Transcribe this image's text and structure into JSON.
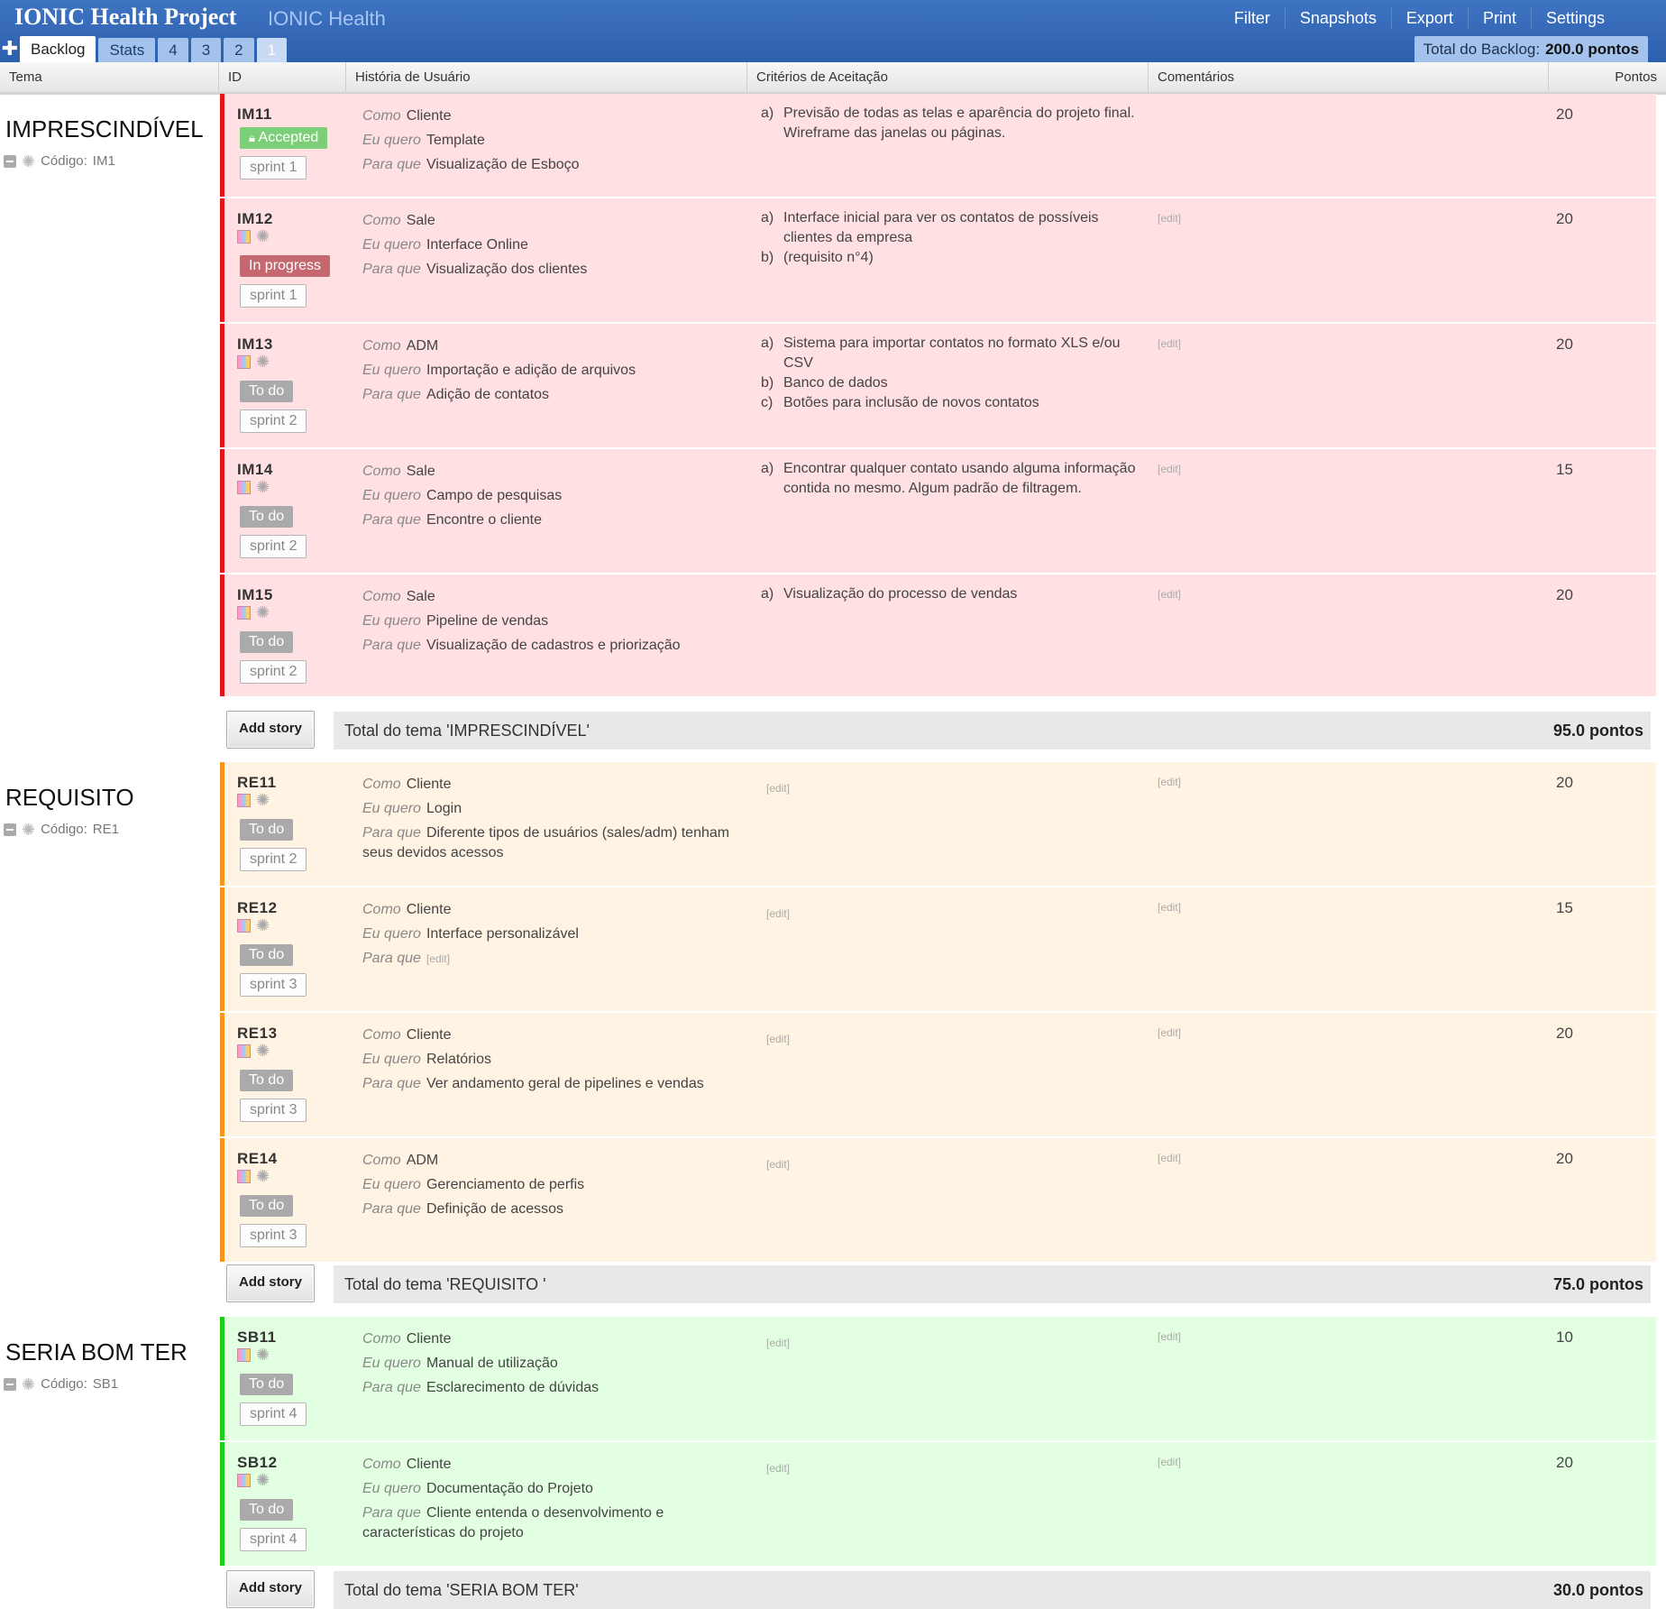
{
  "header": {
    "title": "IONIC Health Project",
    "subtitle": "IONIC Health",
    "menu": [
      "Filter",
      "Snapshots",
      "Export",
      "Print",
      "Settings"
    ],
    "tabs": [
      "Backlog",
      "Stats",
      "4",
      "3",
      "2",
      "1"
    ],
    "total_label": "Total do Backlog:",
    "total_value": "200.0 pontos"
  },
  "columns": [
    "Tema",
    "ID",
    "História de Usuário",
    "Critérios de Aceitação",
    "Comentários",
    "Pontos"
  ],
  "labels": {
    "como": "Como",
    "eu_quero": "Eu quero",
    "para_que": "Para que",
    "edit": "[edit]",
    "add_story": "Add story",
    "codigo": "Código:"
  },
  "colors": {
    "imprescindivel_bg": "#ffe0e3",
    "imprescindivel_bar": "#e3141d",
    "requisito_bg": "#fff3e3",
    "requisito_bar": "#f7941d",
    "seria_bg": "#e2ffe2",
    "seria_bar": "#1ccd1c"
  },
  "themes": [
    {
      "name": "IMPRESCINDÍVEL",
      "code": "IM1",
      "total_label": "Total do tema 'IMPRESCINDÍVEL'",
      "total_value": "95.0 pontos",
      "stories": [
        {
          "id": "IM11",
          "status": "Accepted",
          "sprint": "sprint 1",
          "como": "Cliente",
          "eu_quero": "Template",
          "para_que": "Visualização de Esboço",
          "criteria": [
            {
              "l": "a)",
              "t": "Previsão de todas as telas e aparência do projeto final. Wireframe das janelas ou páginas."
            }
          ],
          "points": "20"
        },
        {
          "id": "IM12",
          "status": "In progress",
          "sprint": "sprint 1",
          "como": "Sale",
          "eu_quero": "Interface Online",
          "para_que": "Visualização dos clientes",
          "criteria": [
            {
              "l": "a)",
              "t": "Interface inicial para ver os contatos de possíveis clientes da empresa"
            },
            {
              "l": "b)",
              "t": "(requisito n°4)"
            }
          ],
          "points": "20"
        },
        {
          "id": "IM13",
          "status": "To do",
          "sprint": "sprint 2",
          "como": "ADM",
          "eu_quero": "Importação e adição de arquivos",
          "para_que": "Adição de contatos",
          "criteria": [
            {
              "l": "a)",
              "t": "Sistema para importar contatos no formato XLS e/ou CSV"
            },
            {
              "l": "b)",
              "t": "Banco de dados"
            },
            {
              "l": "c)",
              "t": "Botões para inclusão de novos contatos"
            }
          ],
          "points": "20"
        },
        {
          "id": "IM14",
          "status": "To do",
          "sprint": "sprint 2",
          "como": "Sale",
          "eu_quero": "Campo de pesquisas",
          "para_que": "Encontre o cliente",
          "criteria": [
            {
              "l": "a)",
              "t": "Encontrar qualquer contato usando alguma informação contida no mesmo. Algum padrão de filtragem."
            }
          ],
          "points": "15"
        },
        {
          "id": "IM15",
          "status": "To do",
          "sprint": "sprint 2",
          "como": "Sale",
          "eu_quero": "Pipeline de vendas",
          "para_que": "Visualização de cadastros e priorização",
          "criteria": [
            {
              "l": "a)",
              "t": "Visualização do processo de vendas"
            }
          ],
          "points": "20"
        }
      ]
    },
    {
      "name": "REQUISITO",
      "code": "RE1",
      "total_label": "Total do tema 'REQUISITO '",
      "total_value": "75.0 pontos",
      "stories": [
        {
          "id": "RE11",
          "status": "To do",
          "sprint": "sprint 2",
          "como": "Cliente",
          "eu_quero": "Login",
          "para_que": "Diferente tipos de usuários (sales/adm) tenham seus devidos acessos",
          "criteria": [],
          "points": "20"
        },
        {
          "id": "RE12",
          "status": "To do",
          "sprint": "sprint 3",
          "como": "Cliente",
          "eu_quero": "Interface personalizável",
          "para_que": "",
          "criteria": [],
          "points": "15"
        },
        {
          "id": "RE13",
          "status": "To do",
          "sprint": "sprint 3",
          "como": "Cliente",
          "eu_quero": "Relatórios",
          "para_que": "Ver andamento geral de pipelines e vendas",
          "criteria": [],
          "points": "20"
        },
        {
          "id": "RE14",
          "status": "To do",
          "sprint": "sprint 3",
          "como": "ADM",
          "eu_quero": "Gerenciamento de perfis",
          "para_que": "Definição de acessos",
          "criteria": [],
          "points": "20"
        }
      ]
    },
    {
      "name": "SERIA BOM TER",
      "code": "SB1",
      "total_label": "Total do tema 'SERIA BOM TER'",
      "total_value": "30.0 pontos",
      "stories": [
        {
          "id": "SB11",
          "status": "To do",
          "sprint": "sprint 4",
          "como": "Cliente",
          "eu_quero": "Manual de utilização",
          "para_que": "Esclarecimento de dúvidas",
          "criteria": [],
          "points": "10"
        },
        {
          "id": "SB12",
          "status": "To do",
          "sprint": "sprint 4",
          "como": "Cliente",
          "eu_quero": "Documentação do Projeto",
          "para_que": "Cliente entenda o desenvolvimento e características do projeto",
          "criteria": [],
          "points": "20"
        }
      ]
    }
  ]
}
